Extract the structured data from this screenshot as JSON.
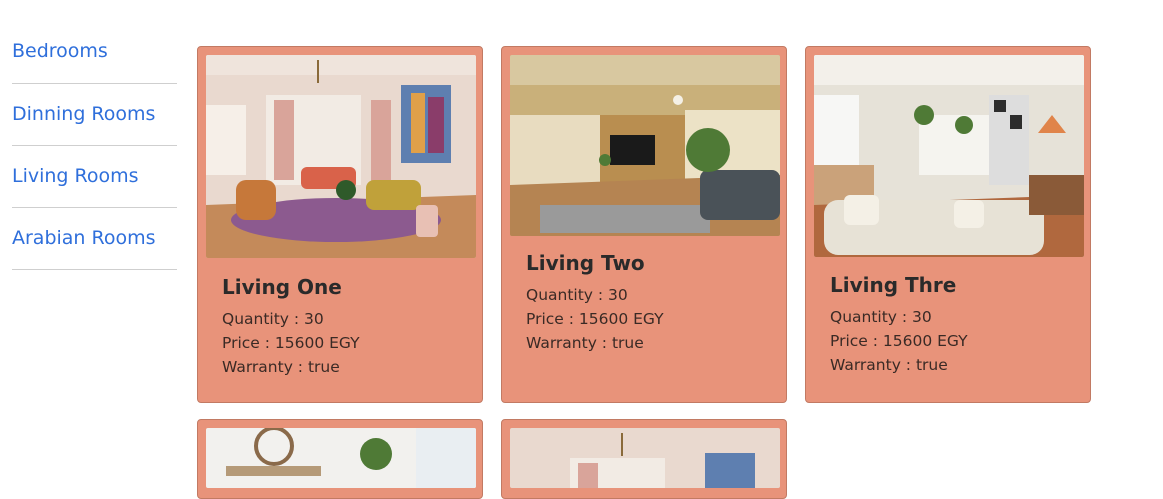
{
  "sidebar": {
    "items": [
      {
        "label": "Bedrooms"
      },
      {
        "label": "Dinning Rooms"
      },
      {
        "label": "Living Rooms"
      },
      {
        "label": "Arabian Rooms"
      }
    ]
  },
  "products": [
    {
      "title": "Living One",
      "quantity": "Quantity : 30",
      "price": "Price : 15600 EGY",
      "warranty": "Warranty : true"
    },
    {
      "title": "Living Two",
      "quantity": "Quantity : 30",
      "price": "Price : 15600 EGY",
      "warranty": "Warranty : true"
    },
    {
      "title": "Living Thre",
      "quantity": "Quantity : 30",
      "price": "Price : 15600 EGY",
      "warranty": "Warranty : true"
    }
  ],
  "colors": {
    "card_bg": "#e8937a",
    "link": "#2f6fdb"
  }
}
